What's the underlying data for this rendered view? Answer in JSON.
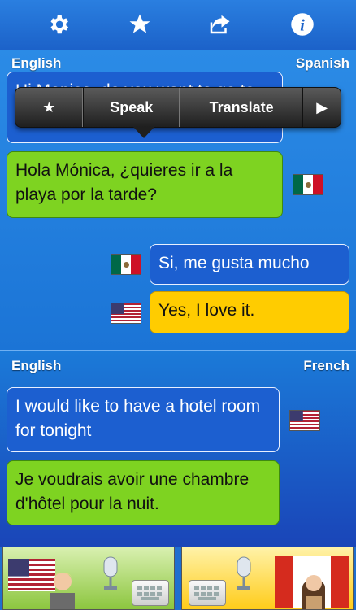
{
  "toolbar": {
    "icons": [
      "gear-icon",
      "star-icon",
      "share-icon",
      "info-icon"
    ]
  },
  "conversation1": {
    "source_language": "English",
    "target_language": "Spanish",
    "source_text": "Hi Monica, do you want to go to the beach this afternoon?",
    "translated_text": "Hola Mónica, ¿quieres ir a la playa por la tarde?",
    "reply_text": "Si, me gusta mucho",
    "reply_translation": "Yes, I love it."
  },
  "popup": {
    "star_label": "★",
    "speak_label": "Speak",
    "translate_label": "Translate",
    "next_label": "▶"
  },
  "conversation2": {
    "source_language": "English",
    "target_language": "French",
    "source_text": "I would like to have a hotel room for tonight",
    "translated_text": "Je voudrais avoir une chambre d'hôtel pour la nuit."
  },
  "bottom_panels": {
    "left": {
      "flag": "us-flag",
      "person": "male-avatar",
      "mic": "microphone-icon",
      "keyboard": "keyboard-icon"
    },
    "right": {
      "flag": "canada-flag",
      "person": "female-avatar",
      "mic": "microphone-icon",
      "keyboard": "keyboard-icon"
    }
  },
  "colors": {
    "toolbar": "#1c62c9",
    "green_bubble": "#7ed321",
    "yellow_bubble": "#ffcc00",
    "blue_bubble": "#1c5fd0"
  }
}
